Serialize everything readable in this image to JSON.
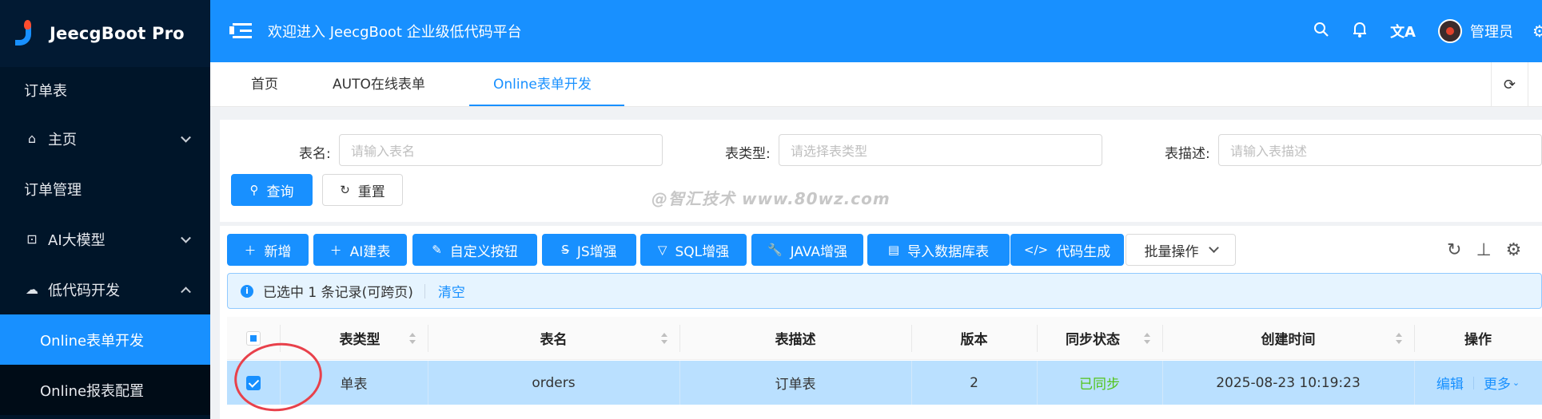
{
  "app": {
    "name": "JeecgBoot Pro"
  },
  "sidebar": {
    "items": [
      {
        "label": "订单表",
        "icon": ""
      },
      {
        "label": "主页",
        "icon": "home-icon"
      },
      {
        "label": "订单管理",
        "icon": ""
      },
      {
        "label": "AI大模型",
        "icon": "ai-model-icon"
      },
      {
        "label": "低代码开发",
        "icon": "cloud-icon"
      },
      {
        "label": "Online表单开发",
        "active": true
      },
      {
        "label": "Online报表配置"
      }
    ]
  },
  "header": {
    "title": "欢迎进入 JeecgBoot 企业级低代码平台",
    "user": "管理员"
  },
  "tabs": [
    "首页",
    "AUTO在线表单",
    "Online表单开发"
  ],
  "search": {
    "fields": [
      {
        "label": "表名:",
        "placeholder": "请输入表名"
      },
      {
        "label": "表类型:",
        "placeholder": "请选择表类型"
      },
      {
        "label": "表描述:",
        "placeholder": "请输入表描述"
      }
    ],
    "query_label": "查询",
    "reset_label": "重置"
  },
  "watermark": "@智汇技术 www.80wz.com",
  "toolbar": {
    "buttons": [
      {
        "label": "新增",
        "icon": "plus-icon"
      },
      {
        "label": "AI建表",
        "icon": "plus-icon"
      },
      {
        "label": "自定义按钮",
        "icon": "pen-icon"
      },
      {
        "label": "JS增强",
        "icon": "strikethrough-icon"
      },
      {
        "label": "SQL增强",
        "icon": "filter-icon"
      },
      {
        "label": "JAVA增强",
        "icon": "wrench-icon"
      },
      {
        "label": "导入数据库表",
        "icon": "file-icon"
      },
      {
        "label": "代码生成",
        "icon": "code-icon"
      }
    ],
    "batch_label": "批量操作"
  },
  "alert": {
    "text": "已选中 1 条记录(可跨页)",
    "clear_label": "清空"
  },
  "table": {
    "columns": [
      "表类型",
      "表名",
      "表描述",
      "版本",
      "同步状态",
      "创建时间",
      "操作"
    ],
    "rows": [
      {
        "type": "单表",
        "name": "orders",
        "desc": "订单表",
        "version": "2",
        "sync": "已同步",
        "created": "2025-08-23 10:19:23",
        "edit": "编辑",
        "more": "更多"
      }
    ]
  },
  "colors": {
    "primary": "#1890ff",
    "sidebar": "#001529",
    "success": "#52c41a",
    "annotation": "#e8414b"
  }
}
